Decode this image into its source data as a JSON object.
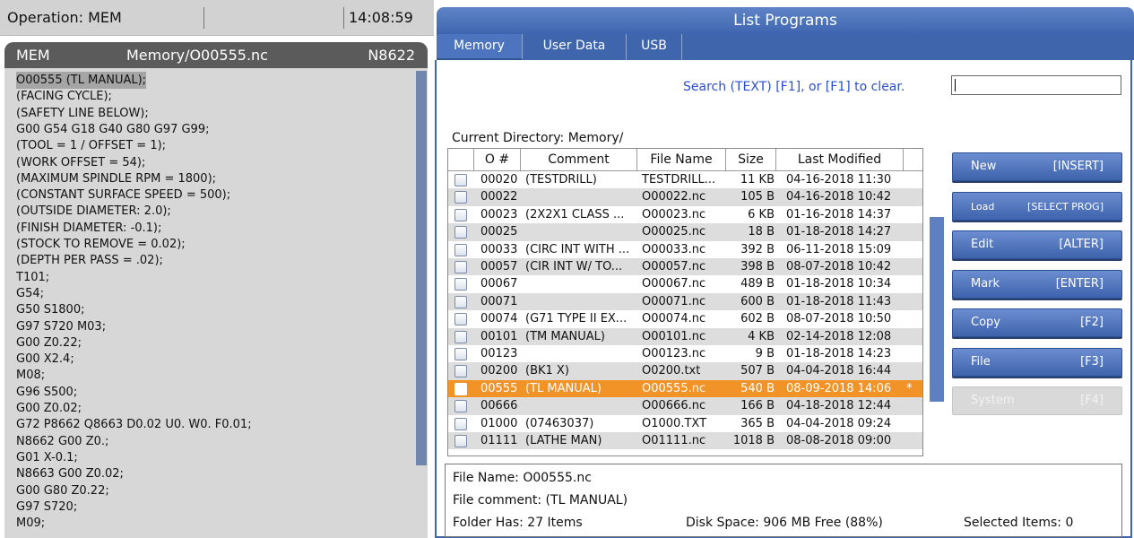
{
  "status": {
    "operation": "Operation: MEM",
    "time": "14:08:59"
  },
  "editor": {
    "mode": "MEM",
    "file": "Memory/O00555.nc",
    "n_number": "N8622",
    "lines": [
      "O00555 (TL MANUAL);",
      "(FACING CYCLE);",
      "(SAFETY LINE BELOW);",
      "G00 G54 G18 G40 G80 G97 G99;",
      "(TOOL = 1 / OFFSET = 1);",
      "(WORK OFFSET = 54);",
      "(MAXIMUM SPINDLE RPM = 1800);",
      "(CONSTANT SURFACE SPEED = 500);",
      "(OUTSIDE DIAMETER: 2.0);",
      "(FINISH DIAMETER: -0.1);",
      "(STOCK TO REMOVE = 0.02);",
      "(DEPTH PER PASS = .02);",
      "T101;",
      "G54;",
      "G50 S1800;",
      "G97 S720 M03;",
      "G00 Z0.22;",
      "G00 X2.4;",
      "M08;",
      "G96 S500;",
      "G00 Z0.02;",
      "G72 P8662 Q8663 D0.02 U0. W0. F0.01;",
      "N8662 G00 Z0.;",
      "G01 X-0.1;",
      "N8663 G00 Z0.02;",
      "G00 G80 Z0.22;",
      "G97 S720;",
      "M09;"
    ]
  },
  "list_programs": {
    "title": "List Programs",
    "tabs": [
      "Memory",
      "User Data",
      "USB"
    ],
    "search_hint": "Search (TEXT) [F1], or [F1] to clear.",
    "search_value": "",
    "current_directory": "Current Directory: Memory/",
    "columns": [
      "O #",
      "Comment",
      "File Name",
      "Size",
      "Last Modified"
    ],
    "rows": [
      {
        "onum": "00020",
        "comment": "(TESTDRILL)",
        "file": "TESTDRILL...",
        "size": "11 KB",
        "modified": "04-16-2018 11:30",
        "star": ""
      },
      {
        "onum": "00022",
        "comment": "",
        "file": "O00022.nc",
        "size": "105 B",
        "modified": "04-16-2018 10:42",
        "star": ""
      },
      {
        "onum": "00023",
        "comment": "(2X2X1 CLASS ...",
        "file": "O00023.nc",
        "size": "6 KB",
        "modified": "01-16-2018 14:37",
        "star": ""
      },
      {
        "onum": "00025",
        "comment": "",
        "file": "O00025.nc",
        "size": "18 B",
        "modified": "01-18-2018 14:27",
        "star": ""
      },
      {
        "onum": "00033",
        "comment": "(CIRC INT WITH ...",
        "file": "O00033.nc",
        "size": "392 B",
        "modified": "06-11-2018 15:09",
        "star": ""
      },
      {
        "onum": "00057",
        "comment": "(CIR INT W/ TO...",
        "file": "O00057.nc",
        "size": "398 B",
        "modified": "08-07-2018 10:42",
        "star": ""
      },
      {
        "onum": "00067",
        "comment": "",
        "file": "O00067.nc",
        "size": "489 B",
        "modified": "01-18-2018 10:34",
        "star": ""
      },
      {
        "onum": "00071",
        "comment": "",
        "file": "O00071.nc",
        "size": "600 B",
        "modified": "01-18-2018 11:43",
        "star": ""
      },
      {
        "onum": "00074",
        "comment": "(G71 TYPE II EX...",
        "file": "O00074.nc",
        "size": "602 B",
        "modified": "08-07-2018 10:50",
        "star": ""
      },
      {
        "onum": "00101",
        "comment": "(TM MANUAL)",
        "file": "O00101.nc",
        "size": "4 KB",
        "modified": "02-14-2018 12:08",
        "star": ""
      },
      {
        "onum": "00123",
        "comment": "",
        "file": "O00123.nc",
        "size": "9 B",
        "modified": "01-18-2018 14:23",
        "star": ""
      },
      {
        "onum": "00200",
        "comment": "(BK1 X)",
        "file": "O0200.txt",
        "size": "507 B",
        "modified": "04-04-2018 16:44",
        "star": ""
      },
      {
        "onum": "00555",
        "comment": "(TL MANUAL)",
        "file": "O00555.nc",
        "size": "540 B",
        "modified": "08-09-2018 14:06",
        "star": "*"
      },
      {
        "onum": "00666",
        "comment": "",
        "file": "O00666.nc",
        "size": "166 B",
        "modified": "04-18-2018 12:44",
        "star": ""
      },
      {
        "onum": "01000",
        "comment": "(07463037)",
        "file": "O1000.TXT",
        "size": "365 B",
        "modified": "04-04-2018 09:24",
        "star": ""
      },
      {
        "onum": "01111",
        "comment": "(LATHE MAN)",
        "file": "O01111.nc",
        "size": "1018 B",
        "modified": "08-08-2018 09:00",
        "star": ""
      }
    ],
    "buttons": [
      {
        "label": "New",
        "key": "[INSERT]"
      },
      {
        "label": "Load",
        "key": "[SELECT PROG]"
      },
      {
        "label": "Edit",
        "key": "[ALTER]"
      },
      {
        "label": "Mark",
        "key": "[ENTER]"
      },
      {
        "label": "Copy",
        "key": "[F2]"
      },
      {
        "label": "File",
        "key": "[F3]"
      },
      {
        "label": "System",
        "key": "[F4]"
      }
    ],
    "info": {
      "file_name": "File Name: O00555.nc",
      "file_comment": "File comment: (TL MANUAL)",
      "folder_has": "Folder Has: 27 Items",
      "disk_space": "Disk Space: 906 MB Free (88%)",
      "selected_items": "Selected Items: 0"
    }
  },
  "colors": {
    "accent_blue": "#3f65ad",
    "selected_row": "#f29328",
    "search_text": "#2b4fd0"
  }
}
